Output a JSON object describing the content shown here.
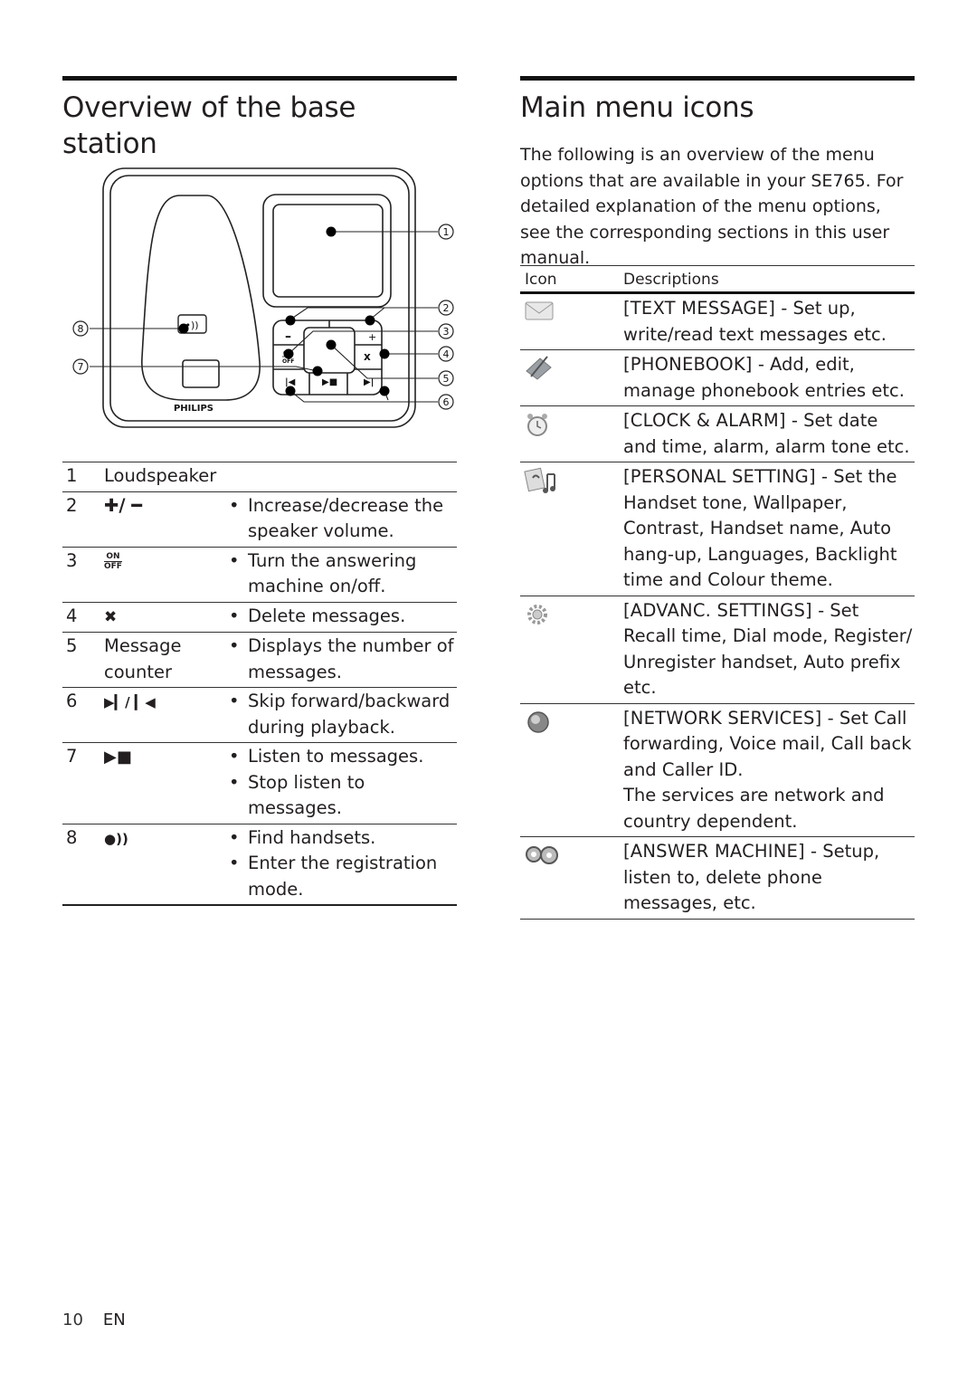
{
  "left": {
    "title": "Overview of the base station",
    "diagram": {
      "brand": "PHILIPS",
      "callouts": [
        "1",
        "2",
        "3",
        "4",
        "5",
        "6",
        "7",
        "8"
      ],
      "button_labels": {
        "minus": "−",
        "plus": "+",
        "on": "ON",
        "off": "OFF",
        "delete": "x",
        "prev": "⏮",
        "next": "⏭",
        "playstop": "▶■"
      }
    },
    "table": [
      {
        "num": "1",
        "label": "Loudspeaker",
        "symbol": "",
        "bullets": []
      },
      {
        "num": "2",
        "label": "",
        "symbol": "✚/ ━",
        "bullets": [
          "Increase/decrease the speaker volume."
        ]
      },
      {
        "num": "3",
        "label": "",
        "symbol": "ON/OFF",
        "bullets": [
          "Turn the answering machine on/off."
        ]
      },
      {
        "num": "4",
        "label": "",
        "symbol": "✖",
        "bullets": [
          "Delete messages."
        ]
      },
      {
        "num": "5",
        "label": "Message counter",
        "symbol": "",
        "bullets": [
          "Displays the number of messages."
        ]
      },
      {
        "num": "6",
        "label": "",
        "symbol": "▶▎ / ▎◀",
        "bullets": [
          "Skip forward/backward during playback."
        ]
      },
      {
        "num": "7",
        "label": "",
        "symbol": "▶■",
        "bullets": [
          "Listen to messages.",
          "Stop listen to messages."
        ]
      },
      {
        "num": "8",
        "label": "",
        "symbol": "●))",
        "bullets": [
          "Find handsets.",
          "Enter the registration mode."
        ]
      }
    ]
  },
  "right": {
    "title": "Main menu icons",
    "intro": "The following is an overview of the menu options that are available in your SE765. For detailed explanation of the menu options, see the corresponding sections in this user manual.",
    "table_header": {
      "icon": "Icon",
      "desc": "Descriptions"
    },
    "menu": [
      {
        "icon": "envelope-icon",
        "name": "[TEXT MESSAGE]",
        "desc": " - Set up, write/read text messages etc."
      },
      {
        "icon": "phonebook-icon",
        "name": "[PHONEBOOK]",
        "desc": " - Add, edit, manage phonebook entries etc."
      },
      {
        "icon": "alarm-clock-icon",
        "name": "[CLOCK & ALARM]",
        "desc": " - Set date and time, alarm, alarm tone etc."
      },
      {
        "icon": "music-note-icon",
        "name": "[PERSONAL SETTING]",
        "desc": " - Set the Handset tone, Wallpaper, Contrast, Handset name, Auto hang-up, Languages, Backlight time and Colour theme."
      },
      {
        "icon": "gear-icon",
        "name": "[ADVANC. SETTINGS]",
        "desc": " - Set Recall time, Dial mode, Register/ Unregister handset, Auto prefix etc."
      },
      {
        "icon": "globe-icon",
        "name": "[NETWORK SERVICES]",
        "desc": " - Set Call forwarding, Voice mail, Call back and Caller ID.",
        "note": "The services are network and country dependent."
      },
      {
        "icon": "tape-icon",
        "name": "[ANSWER MACHINE]",
        "desc": " - Setup, listen to, delete phone messages, etc."
      }
    ]
  },
  "footer": {
    "page": "10",
    "lang": "EN"
  }
}
